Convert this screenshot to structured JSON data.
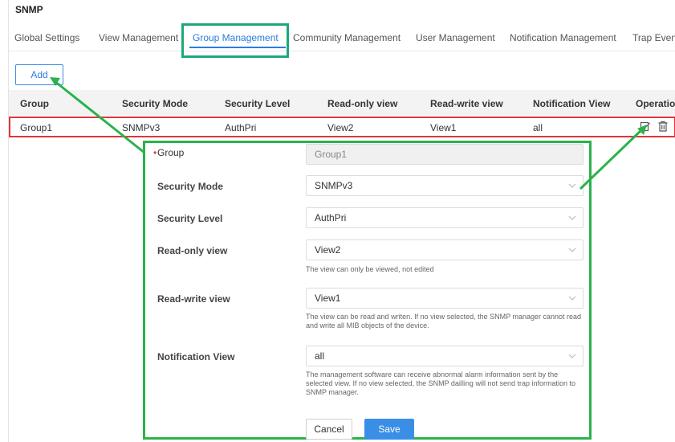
{
  "header": {
    "title": "SNMP"
  },
  "tabs": [
    {
      "label": "Global Settings"
    },
    {
      "label": "View Management"
    },
    {
      "label": "Group Management"
    },
    {
      "label": "Community Management"
    },
    {
      "label": "User Management"
    },
    {
      "label": "Notification Management"
    },
    {
      "label": "Trap Event"
    }
  ],
  "toolbar": {
    "add_label": "Add"
  },
  "table": {
    "columns": [
      "Group",
      "Security Mode",
      "Security Level",
      "Read-only view",
      "Read-write view",
      "Notification View",
      "Operation"
    ],
    "rows": [
      {
        "group": "Group1",
        "security_mode": "SNMPv3",
        "security_level": "AuthPri",
        "read_only": "View2",
        "read_write": "View1",
        "notification": "all"
      }
    ]
  },
  "form": {
    "group": {
      "label": "Group",
      "value": "Group1"
    },
    "security_mode": {
      "label": "Security Mode",
      "value": "SNMPv3"
    },
    "security_level": {
      "label": "Security Level",
      "value": "AuthPri"
    },
    "read_only": {
      "label": "Read-only view",
      "value": "View2",
      "hint": "The view can only be viewed, not edited"
    },
    "read_write": {
      "label": "Read-write view",
      "value": "View1",
      "hint": "The view can be read and writen. If no view selected, the SNMP manager cannot read and write all MIB objects of the device."
    },
    "notification": {
      "label": "Notification View",
      "value": "all",
      "hint": "The management software can receive abnormal alarm information sent by the selected view. If no view selected, the SNMP dailling will not send trap information to SNMP manager."
    },
    "cancel_label": "Cancel",
    "save_label": "Save"
  },
  "colors": {
    "accent": "#2a7ce0",
    "highlight_green": "#2bb24c",
    "highlight_red": "#e0363b"
  }
}
